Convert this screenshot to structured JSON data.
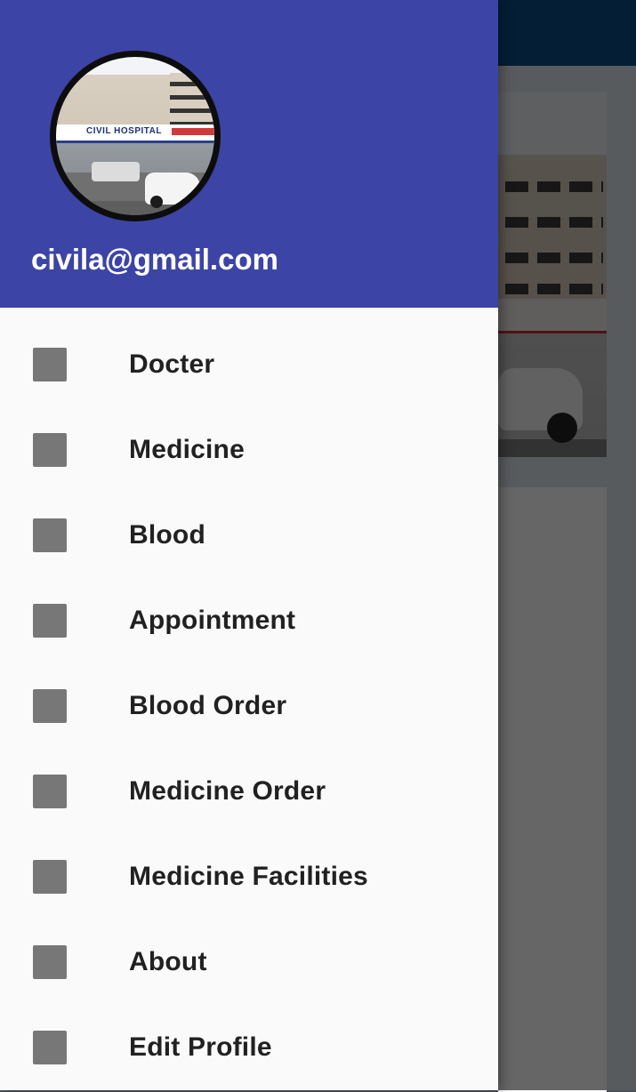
{
  "theme": {
    "header_color": "#3c44a6",
    "toolbar_color": "#0a4c86",
    "drawer_background": "#fafafa",
    "icon_color": "#777777",
    "label_color": "#212121"
  },
  "header": {
    "avatar": {
      "icon": "hospital-photo",
      "sign_text": "CIVIL HOSPITAL"
    },
    "email": "civila@gmail.com"
  },
  "menu": {
    "items": [
      {
        "label": "Docter",
        "icon": "square-placeholder-icon"
      },
      {
        "label": "Medicine",
        "icon": "square-placeholder-icon"
      },
      {
        "label": "Blood",
        "icon": "square-placeholder-icon"
      },
      {
        "label": "Appointment",
        "icon": "square-placeholder-icon"
      },
      {
        "label": "Blood Order",
        "icon": "square-placeholder-icon"
      },
      {
        "label": "Medicine Order",
        "icon": "square-placeholder-icon"
      },
      {
        "label": "Medicine Facilities",
        "icon": "square-placeholder-icon"
      },
      {
        "label": "About",
        "icon": "square-placeholder-icon"
      },
      {
        "label": "Edit Profile",
        "icon": "square-placeholder-icon"
      }
    ]
  }
}
